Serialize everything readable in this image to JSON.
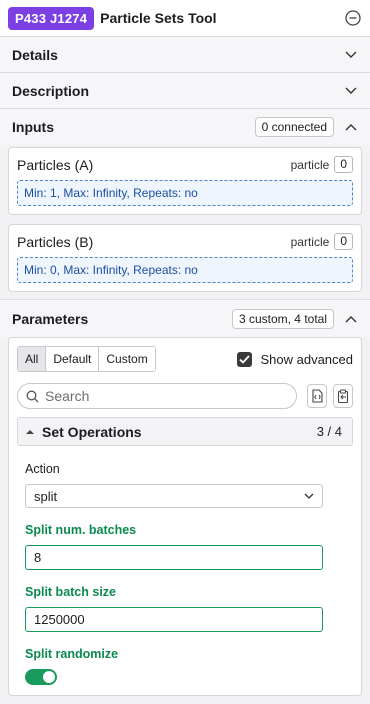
{
  "header": {
    "job_id": "P433 J1274",
    "title": "Particle Sets Tool"
  },
  "sections": {
    "details": {
      "label": "Details"
    },
    "description": {
      "label": "Description"
    },
    "inputs": {
      "label": "Inputs",
      "badge": "0 connected"
    },
    "parameters": {
      "label": "Parameters",
      "badge": "3 custom, 4 total"
    }
  },
  "inputs": [
    {
      "name": "Particles (A)",
      "type": "particle",
      "count": "0",
      "constraint": "Min: 1, Max: Infinity, Repeats: no"
    },
    {
      "name": "Particles (B)",
      "type": "particle",
      "count": "0",
      "constraint": "Min: 0, Max: Infinity, Repeats: no"
    }
  ],
  "params": {
    "filter_tabs": [
      "All",
      "Default",
      "Custom"
    ],
    "active_tab": "All",
    "show_advanced_label": "Show advanced",
    "show_advanced_checked": true,
    "search_placeholder": "Search",
    "group": {
      "name": "Set Operations",
      "count": "3 / 4"
    },
    "fields": {
      "action": {
        "label": "Action",
        "value": "split"
      },
      "split_num_batches": {
        "label": "Split num. batches",
        "value": "8"
      },
      "split_batch_size": {
        "label": "Split batch size",
        "value": "1250000"
      },
      "split_randomize": {
        "label": "Split randomize",
        "value": true
      }
    }
  },
  "colors": {
    "badge": "#7b3fe4",
    "custom_green": "#0b8a4f",
    "constraint_blue": "#4a86d4"
  }
}
